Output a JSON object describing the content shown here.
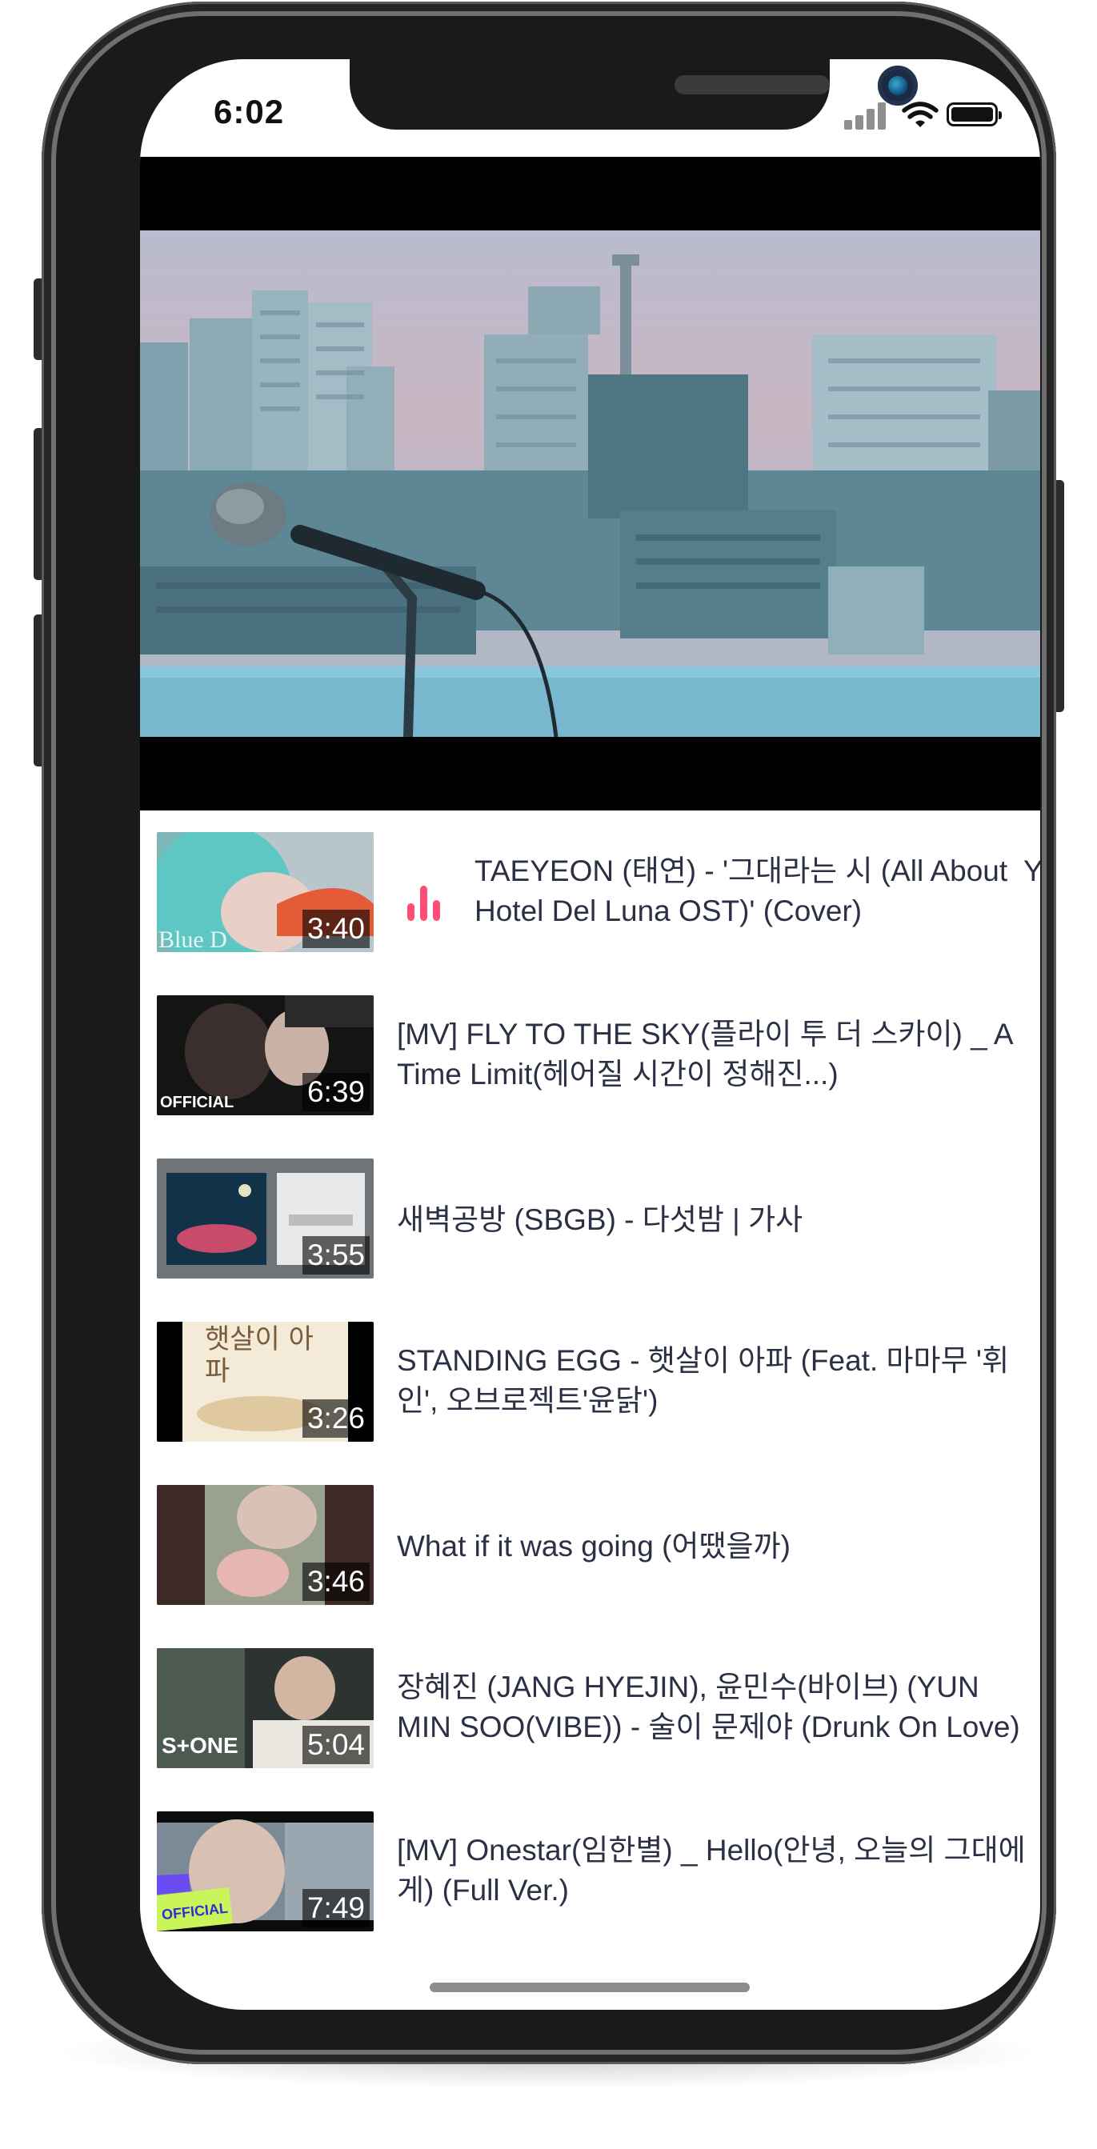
{
  "status_bar": {
    "time": "6:02",
    "icons": [
      "signal-icon",
      "wifi-icon",
      "battery-icon"
    ]
  },
  "player": {
    "description_icon": "video-frame",
    "colors": {
      "letterbox": "#000000"
    }
  },
  "videos": [
    {
      "title": "TAEYEON (태연) - '그대라는 시 (All About  You, Hotel Del Luna OST)' (Cover)",
      "duration": "3:40",
      "playing": true,
      "thumb_overlay": "Blue D"
    },
    {
      "title": "[MV] FLY TO THE SKY(플라이 투 더 스카이) _ A Time Limit(헤어질 시간이 정해진...)",
      "duration": "6:39",
      "playing": false,
      "thumb_overlay": "OFFICIAL"
    },
    {
      "title": "새벽공방 (SBGB) - 다섯밤 | 가사",
      "duration": "3:55",
      "playing": false
    },
    {
      "title": "STANDING EGG - 햇살이 아파 (Feat. 마마무 '휘인', 오브로젝트'윤닭')",
      "duration": "3:26",
      "playing": false,
      "thumb_overlay": "햇살이 아파"
    },
    {
      "title": "What if it was going (어땠을까)",
      "duration": "3:46",
      "playing": false
    },
    {
      "title": "장혜진 (JANG HYEJIN), 윤민수(바이브) (YUN MIN SOO(VIBE)) - 술이 문제야 (Drunk On Love)",
      "duration": "5:04",
      "playing": false,
      "thumb_overlay": "S+ONE"
    },
    {
      "title": "[MV] Onestar(임한별) _ Hello(안녕, 오늘의 그대에게) (Full Ver.)",
      "duration": "7:49",
      "playing": false,
      "thumb_overlay": "OFFICIAL"
    }
  ],
  "colors": {
    "accent_playing": "#ff4d75",
    "title_text": "#2b3045",
    "background": "#ffffff"
  }
}
